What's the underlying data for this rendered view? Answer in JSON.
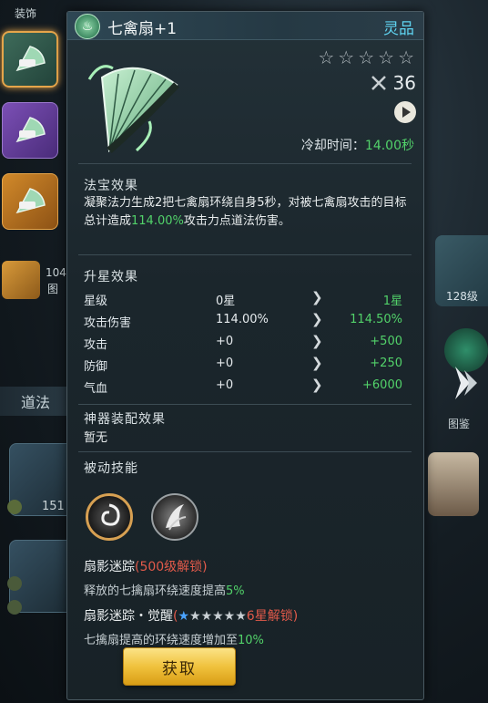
{
  "background": {
    "left_header": "装饰",
    "left_card_text_a": "104",
    "left_card_text_b": "图",
    "dao_tab": "道法",
    "left_count": "151",
    "right_level": "128级",
    "right_label": "图鉴"
  },
  "panel": {
    "title": "七禽扇+1",
    "quality": "灵品",
    "stars": [
      "☆",
      "☆",
      "☆",
      "☆",
      "☆"
    ],
    "power": "36",
    "cooldown_label": "冷却时间：",
    "cooldown_value": "14.00秒"
  },
  "effect": {
    "title": "法宝效果",
    "text_a": "凝聚法力生成2把七禽扇环绕自身5秒，对被七禽扇攻击的目标总计造成",
    "text_pct": "114.00%",
    "text_b": "攻击力点道法伤害。"
  },
  "upgrade": {
    "title": "升星效果",
    "rows": [
      {
        "label": "星级",
        "current": "0星",
        "next": "1星"
      },
      {
        "label": "攻击伤害",
        "current": "114.00%",
        "next": "114.50%"
      },
      {
        "label": "攻击",
        "current": "+0",
        "next": "+500"
      },
      {
        "label": "防御",
        "current": "+0",
        "next": "+250"
      },
      {
        "label": "气血",
        "current": "+0",
        "next": "+6000"
      }
    ]
  },
  "artifact": {
    "title": "神器装配效果",
    "value": "暂无"
  },
  "passive": {
    "title": "被动技能",
    "skill1_name": "扇影迷踪",
    "skill1_lock": "(500级解锁)",
    "skill1_desc": "释放的七擒扇环绕速度提高",
    "skill1_pct": "5%",
    "skill2_name": "扇影迷踪・觉醒",
    "skill2_open": "(",
    "skill2_lock": "6星解锁)",
    "skill2_desc": "七擒扇提高的环绕速度增加至",
    "skill2_pct": "10%"
  },
  "button": {
    "get_label": "获取"
  }
}
